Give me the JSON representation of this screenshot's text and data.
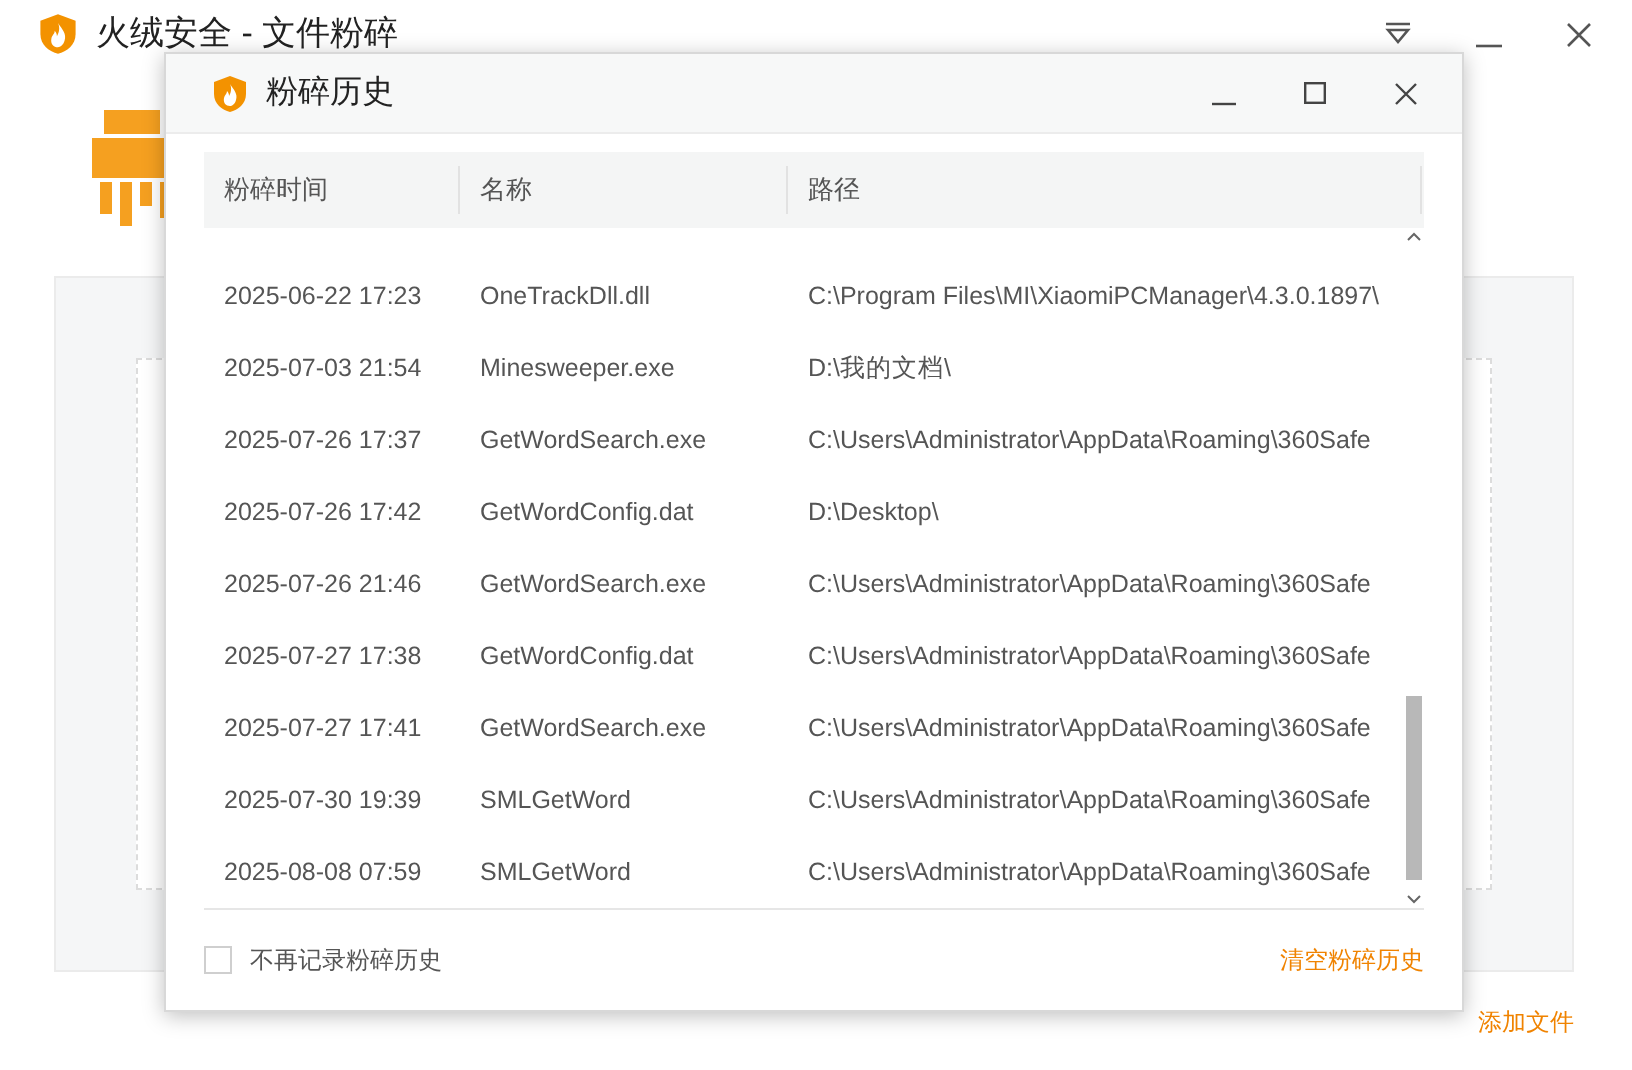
{
  "window": {
    "title": "火绒安全 - 文件粉碎"
  },
  "dialog": {
    "title": "粉碎历史",
    "columns": [
      "粉碎时间",
      "名称",
      "路径"
    ],
    "rows": [
      {
        "time": "2025-06-22 17:23",
        "name": "OneTrackDll.dll",
        "path": "C:\\Program Files\\MI\\XiaomiPCManager\\4.3.0.1897\\"
      },
      {
        "time": "2025-07-03 21:54",
        "name": "Minesweeper.exe",
        "path": "D:\\我的文档\\"
      },
      {
        "time": "2025-07-26 17:37",
        "name": "GetWordSearch.exe",
        "path": "C:\\Users\\Administrator\\AppData\\Roaming\\360Safe"
      },
      {
        "time": "2025-07-26 17:42",
        "name": "GetWordConfig.dat",
        "path": "D:\\Desktop\\"
      },
      {
        "time": "2025-07-26 21:46",
        "name": "GetWordSearch.exe",
        "path": "C:\\Users\\Administrator\\AppData\\Roaming\\360Safe"
      },
      {
        "time": "2025-07-27 17:38",
        "name": "GetWordConfig.dat",
        "path": "C:\\Users\\Administrator\\AppData\\Roaming\\360Safe"
      },
      {
        "time": "2025-07-27 17:41",
        "name": "GetWordSearch.exe",
        "path": "C:\\Users\\Administrator\\AppData\\Roaming\\360Safe"
      },
      {
        "time": "2025-07-30 19:39",
        "name": "SMLGetWord",
        "path": "C:\\Users\\Administrator\\AppData\\Roaming\\360Safe"
      },
      {
        "time": "2025-08-08 07:59",
        "name": "SMLGetWord",
        "path": "C:\\Users\\Administrator\\AppData\\Roaming\\360Safe"
      }
    ],
    "dont_record": {
      "label": "不再记录粉碎历史",
      "checked": false
    },
    "clear_link": "清空粉碎历史"
  },
  "add_file_link": "添加文件"
}
